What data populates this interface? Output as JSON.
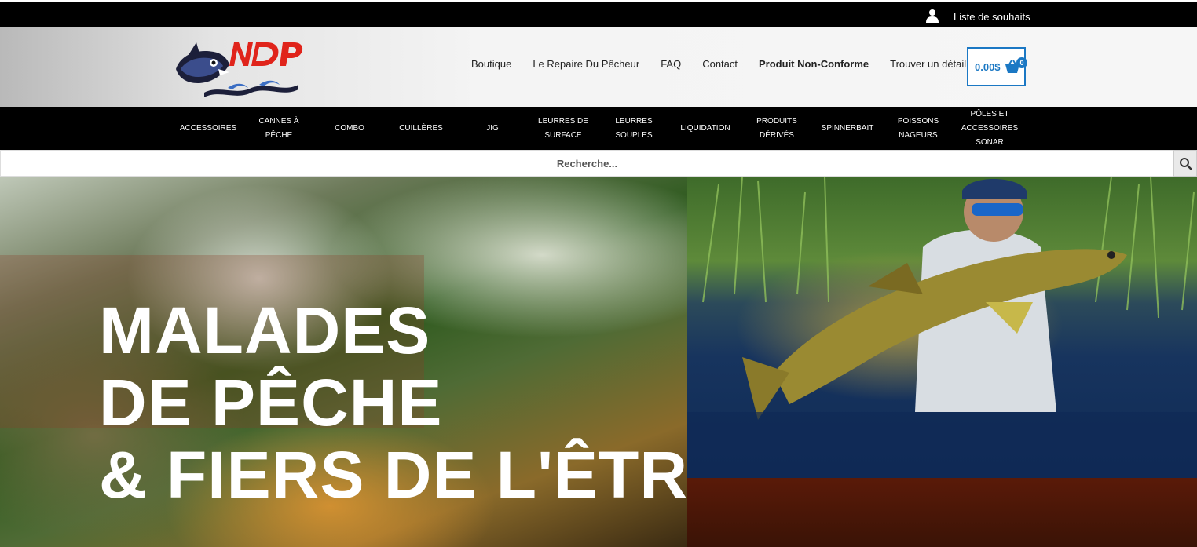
{
  "topbar": {
    "wishlist_label": "Liste de souhaits",
    "wishlist_icon": "user-icon"
  },
  "header": {
    "logo_text": "NDP",
    "nav": [
      {
        "label": "Boutique",
        "bold": false
      },
      {
        "label": "Le Repaire Du Pêcheur",
        "bold": false
      },
      {
        "label": "FAQ",
        "bold": false
      },
      {
        "label": "Contact",
        "bold": false
      },
      {
        "label": "Produit Non-Conforme",
        "bold": true
      },
      {
        "label": "Trouver un détaillant",
        "bold": false
      }
    ],
    "cart": {
      "amount": "0.00$",
      "count": "0",
      "icon": "basket-icon"
    }
  },
  "categories": [
    {
      "line1": "ACCESSOIRES",
      "line2": "",
      "line3": ""
    },
    {
      "line1": "CANNES À",
      "line2": "PÊCHE",
      "line3": ""
    },
    {
      "line1": "COMBO",
      "line2": "",
      "line3": ""
    },
    {
      "line1": "CUILLÈRES",
      "line2": "",
      "line3": ""
    },
    {
      "line1": "JIG",
      "line2": "",
      "line3": ""
    },
    {
      "line1": "LEURRES DE",
      "line2": "SURFACE",
      "line3": ""
    },
    {
      "line1": "LEURRES",
      "line2": "SOUPLES",
      "line3": ""
    },
    {
      "line1": "LIQUIDATION",
      "line2": "",
      "line3": ""
    },
    {
      "line1": "PRODUITS",
      "line2": "DÉRIVÉS",
      "line3": ""
    },
    {
      "line1": "SPINNERBAIT",
      "line2": "",
      "line3": ""
    },
    {
      "line1": "POISSONS",
      "line2": "NAGEURS",
      "line3": ""
    },
    {
      "line1": "PÔLES ET",
      "line2": "ACCESSOIRES",
      "line3": "SONAR"
    }
  ],
  "search": {
    "placeholder": "Recherche...",
    "icon": "search-icon"
  },
  "hero": {
    "line1": "MALADES",
    "line2": "DE PÊCHE",
    "line3": "& FIERS DE L'ÊTRE!"
  },
  "colors": {
    "accent": "#1b78c4",
    "topbar": "#000000",
    "logo_red": "#e0241b"
  }
}
